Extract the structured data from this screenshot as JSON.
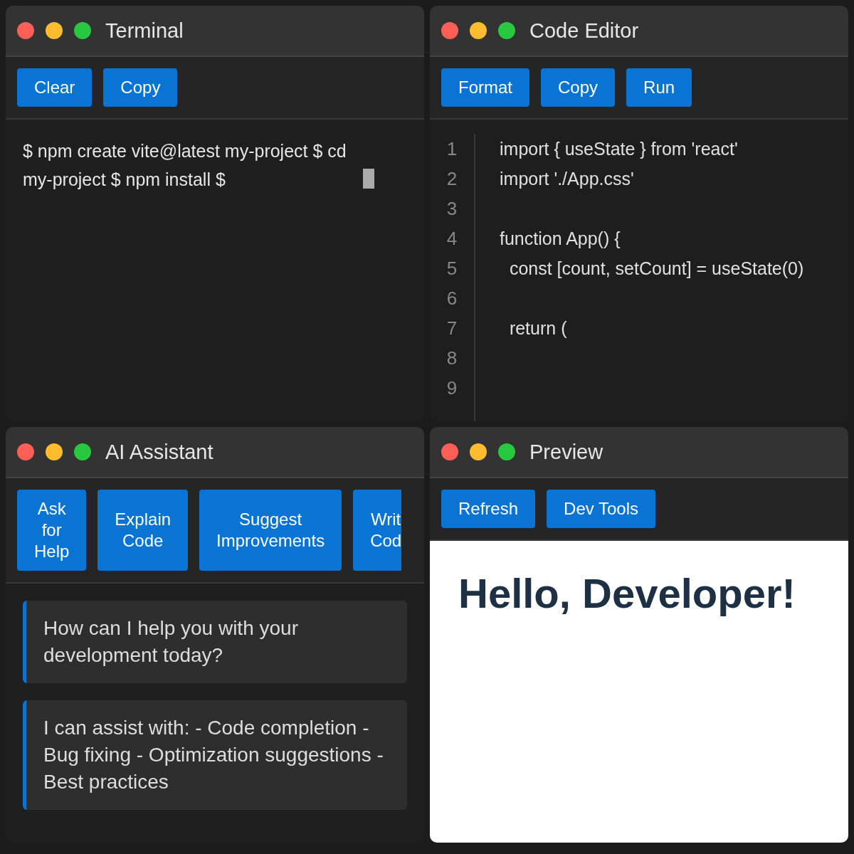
{
  "panels": [
    {
      "kind": "terminal",
      "title": "Terminal",
      "buttons": [
        {
          "label": "Clear",
          "clipped": false
        },
        {
          "label": "Copy",
          "clipped": false
        }
      ],
      "output": "$ npm create vite@latest my-project $ cd my-project $ npm install $"
    },
    {
      "kind": "editor",
      "title": "Code Editor",
      "buttons": [
        {
          "label": "Format",
          "clipped": false
        },
        {
          "label": "Copy",
          "clipped": false
        },
        {
          "label": "Run",
          "clipped": false
        }
      ],
      "lines": [
        {
          "number": "1",
          "code": "import { useState } from 'react'"
        },
        {
          "number": "2",
          "code": "import './App.css'"
        },
        {
          "number": "3"
        },
        {
          "number": "4",
          "code": "function App() {"
        },
        {
          "number": "5",
          "code": "  const [count, setCount] = useState(0)"
        },
        {
          "number": "6"
        },
        {
          "number": "7",
          "code": "  return ("
        },
        {
          "number": "8"
        },
        {
          "number": "9"
        }
      ]
    },
    {
      "kind": "assistant",
      "title": "AI Assistant",
      "buttons": [
        {
          "label": "Ask for Help",
          "clipped": false
        },
        {
          "label": "Explain Code",
          "clipped": false
        },
        {
          "label": "Suggest Improvements",
          "clipped": false
        },
        {
          "label": "Writ Cod",
          "clipped": true
        }
      ],
      "messages": [
        "How can I help you with your development today?",
        "I can assist with: - Code completion - Bug fixing - Optimization suggestions - Best practices"
      ]
    },
    {
      "kind": "preview",
      "title": "Preview",
      "buttons": [
        {
          "label": "Refresh",
          "clipped": false
        },
        {
          "label": "Dev Tools",
          "clipped": false
        }
      ],
      "heading": "Hello, Developer!"
    }
  ]
}
